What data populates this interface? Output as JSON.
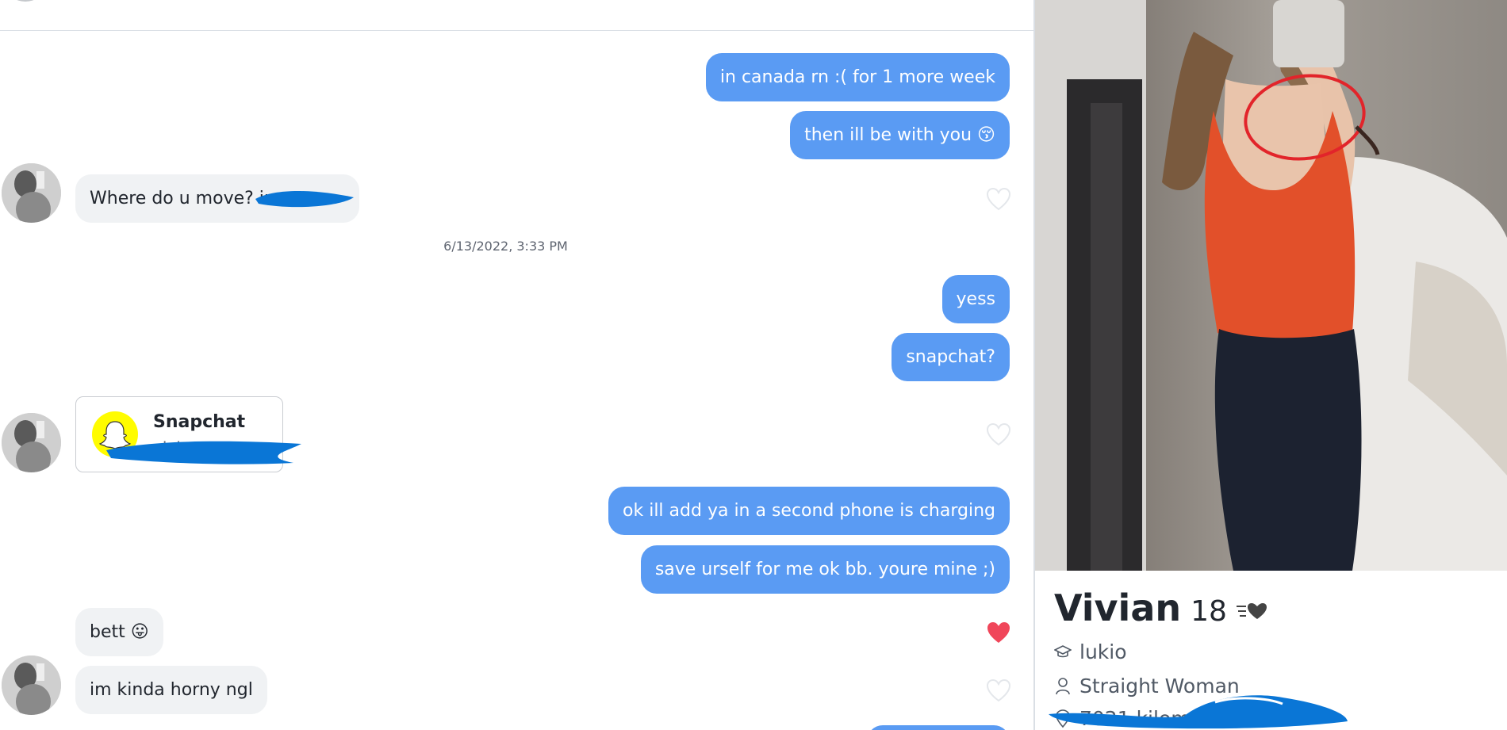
{
  "chat": {
    "messages": [
      {
        "dir": "out",
        "text": "in canada rn :( for 1 more week"
      },
      {
        "dir": "out",
        "text": "then ill be with you 😚"
      },
      {
        "dir": "in",
        "text": "Where do u move? in",
        "liked": false
      },
      {
        "dir": "out",
        "text": "yess"
      },
      {
        "dir": "out",
        "text": "snapchat?"
      },
      {
        "dir": "out",
        "text": "ok ill add ya in a second phone is charging"
      },
      {
        "dir": "out",
        "text": "save urself for me ok bb. youre mine ;)"
      },
      {
        "dir": "in",
        "text": "bett 😛",
        "liked": true
      },
      {
        "dir": "in",
        "text": "im kinda horny ngl",
        "liked": false
      }
    ],
    "timestamp": "6/13/2022, 3:33 PM",
    "snap_card": {
      "title": "Snapchat",
      "username": "vivi"
    },
    "colors": {
      "outgoing": "#5a9bf3",
      "incoming": "#f0f2f4",
      "liked_heart": "#f0465a",
      "redaction": "#0a76d6"
    }
  },
  "profile": {
    "name": "Vivian",
    "age": "18",
    "school": "lukio",
    "orientation": "Straight Woman",
    "distance_partial": "7021 kilom"
  }
}
